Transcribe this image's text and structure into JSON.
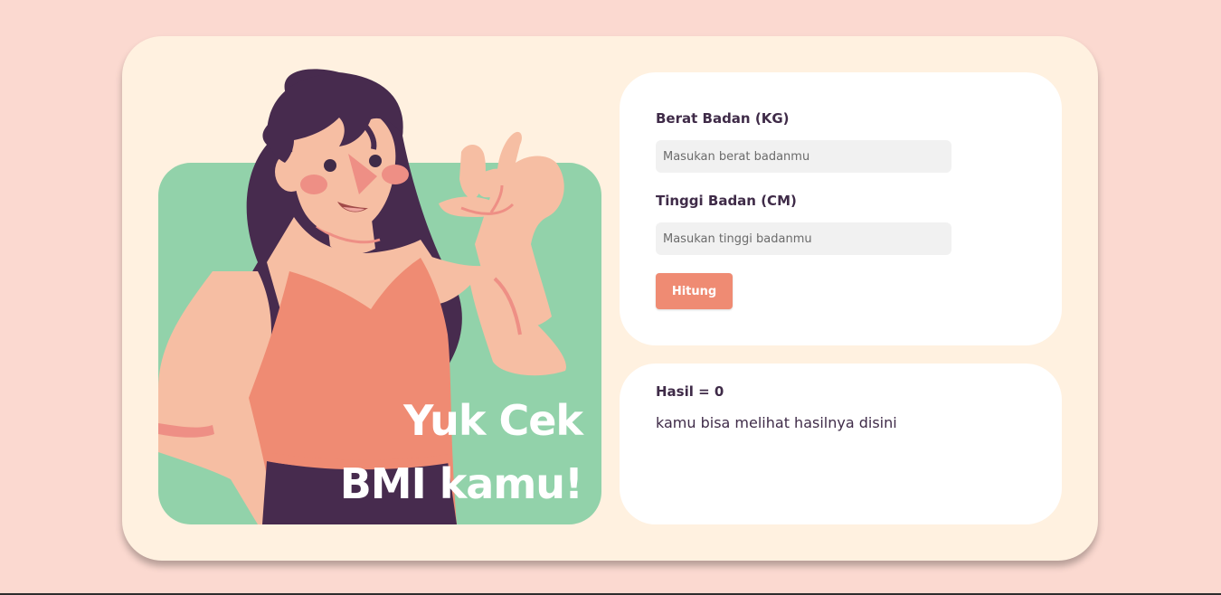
{
  "hero": {
    "title_line1": "Yuk Cek",
    "title_line2": "BMI kamu!"
  },
  "form": {
    "weight_label": "Berat Badan (KG)",
    "weight_placeholder": "Masukan berat badanmu",
    "weight_value": "",
    "height_label": "Tinggi Badan (CM)",
    "height_placeholder": "Masukan tinggi badanmu",
    "height_value": "",
    "submit_label": "Hitung"
  },
  "result": {
    "title": "Hasil = 0",
    "message": "kamu bisa melihat hasilnya disini"
  },
  "colors": {
    "background": "#fbd9d0",
    "card": "#fff1e0",
    "hero_bg": "#92d2aa",
    "accent": "#ef8b73",
    "text_dark": "#3f2b48"
  }
}
